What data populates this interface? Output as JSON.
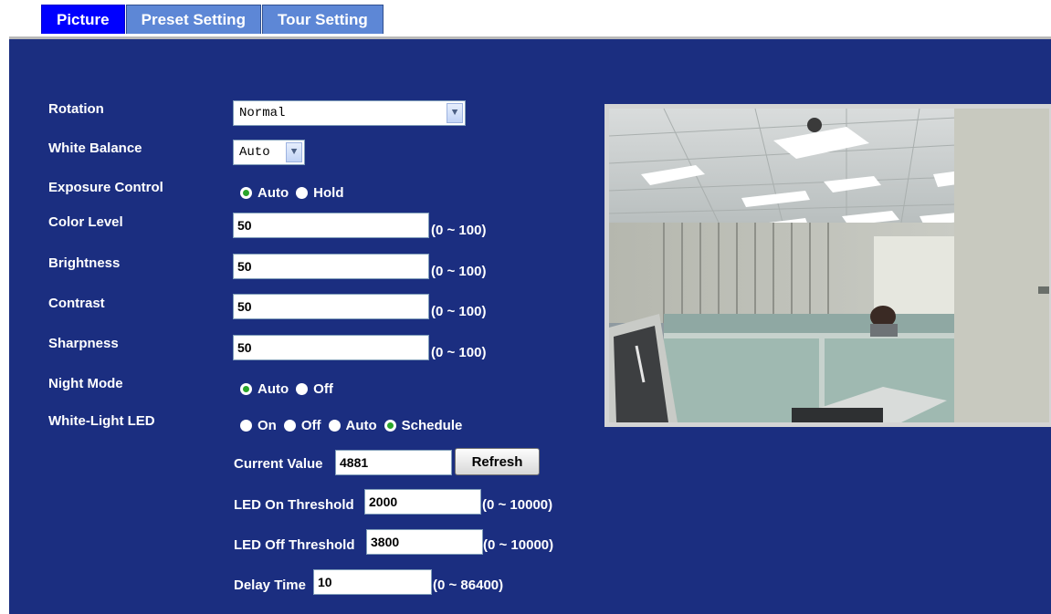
{
  "tabs": [
    {
      "label": "Picture",
      "active": true
    },
    {
      "label": "Preset Setting",
      "active": false
    },
    {
      "label": "Tour Setting",
      "active": false
    }
  ],
  "rotation": {
    "label": "Rotation",
    "value": "Normal"
  },
  "white_balance": {
    "label": "White Balance",
    "value": "Auto"
  },
  "exposure": {
    "label": "Exposure Control",
    "options": [
      "Auto",
      "Hold"
    ],
    "selected": "Auto"
  },
  "color_level": {
    "label": "Color Level",
    "value": "50",
    "range": "(0 ~ 100)"
  },
  "brightness": {
    "label": "Brightness",
    "value": "50",
    "range": "(0 ~ 100)"
  },
  "contrast": {
    "label": "Contrast",
    "value": "50",
    "range": "(0 ~ 100)"
  },
  "sharpness": {
    "label": "Sharpness",
    "value": "50",
    "range": "(0 ~ 100)"
  },
  "night_mode": {
    "label": "Night Mode",
    "options": [
      "Auto",
      "Off"
    ],
    "selected": "Auto"
  },
  "white_light_led": {
    "label": "White-Light LED",
    "options": [
      "On",
      "Off",
      "Auto",
      "Schedule"
    ],
    "selected": "Schedule"
  },
  "current_value": {
    "label": "Current Value",
    "value": "4881",
    "button": "Refresh"
  },
  "led_on": {
    "label": "LED On Threshold",
    "value": "2000",
    "range": "(0 ~ 10000)"
  },
  "led_off": {
    "label": "LED Off Threshold",
    "value": "3800",
    "range": "(0 ~ 10000)"
  },
  "delay": {
    "label": "Delay Time",
    "value": "10",
    "range": "(0 ~ 86400)"
  },
  "colors": {
    "panel": "#1b2e80",
    "tab_active": "#0000ff",
    "tab_inactive": "#5d87d6",
    "radio_checked": "#2aa52a"
  }
}
